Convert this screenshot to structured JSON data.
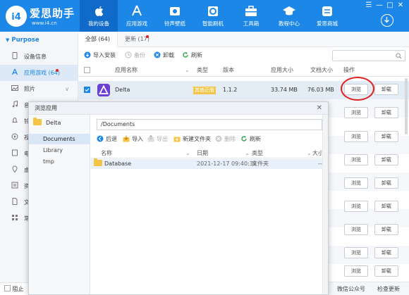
{
  "app": {
    "logo_title": "爱思助手",
    "logo_url": "www.i4.cn",
    "nav": [
      {
        "label": "我的设备",
        "icon": "apple-icon",
        "active": true
      },
      {
        "label": "应用游戏",
        "icon": "app-store-icon"
      },
      {
        "label": "铃声壁纸",
        "icon": "ringtone-icon"
      },
      {
        "label": "智能刷机",
        "icon": "flash-icon"
      },
      {
        "label": "工具箱",
        "icon": "toolbox-icon"
      },
      {
        "label": "教程中心",
        "icon": "graduation-cap-icon"
      },
      {
        "label": "爱思商城",
        "icon": "store-icon"
      }
    ],
    "window_controls": [
      "☰",
      "—",
      "□",
      "✕"
    ]
  },
  "sidebar": {
    "header": "Purpose",
    "items": [
      {
        "label": "设备信息",
        "icon": "phone-icon"
      },
      {
        "label": "应用游戏 (64)",
        "icon": "apps-icon",
        "active": true
      },
      {
        "label": "照片",
        "icon": "photo-icon"
      },
      {
        "label": "音乐",
        "icon": "music-icon"
      },
      {
        "label": "铃声",
        "icon": "bell-icon"
      },
      {
        "label": "视频",
        "icon": "video-icon"
      },
      {
        "label": "电子书",
        "icon": "book-icon"
      },
      {
        "label": "虚拟定位",
        "icon": "location-icon"
      },
      {
        "label": "资料",
        "icon": "contacts-icon"
      },
      {
        "label": "文件",
        "icon": "file-icon"
      },
      {
        "label": "常用",
        "icon": "grid-icon"
      }
    ],
    "bottom_label": "阻止"
  },
  "main": {
    "tabs": [
      {
        "label": "全部 (64)",
        "active": true
      },
      {
        "label": "更新 (17)"
      }
    ],
    "toolbar": {
      "install": "导入安装",
      "backup": "备份",
      "uninstall": "卸载",
      "refresh": "刷新"
    },
    "columns": {
      "name": "应用名称",
      "type": "类型",
      "version": "版本",
      "app_size": "应用大小",
      "doc_size": "文档大小",
      "action": "操作"
    },
    "app_row": {
      "name": "Delta",
      "badge": "其他正版",
      "version": "1.1.2",
      "app_size": "33.74 MB",
      "doc_size": "76.03 MB"
    },
    "browse_label": "浏览",
    "uninstall_label": "卸载"
  },
  "status": {
    "wechat": "微信公众号",
    "update": "检查更新"
  },
  "dialog": {
    "title": "浏览应用",
    "app_name": "Delta",
    "dirs": [
      "Documents",
      "Library",
      "tmp"
    ],
    "path": "/Documents",
    "toolbar": {
      "back": "后退",
      "import": "导入",
      "export": "导出",
      "new_folder": "新建文件夹",
      "delete": "删除",
      "refresh": "刷新"
    },
    "columns": {
      "name": "名称",
      "date": "日期",
      "type": "类型",
      "size": "大小"
    },
    "files": [
      {
        "name": "Database",
        "date": "2021-12-17 09:40:38",
        "type": "文件夹",
        "size": "--"
      }
    ]
  },
  "colors": {
    "brand": "#1c87e6",
    "badge": "#f3c64a",
    "highlight_circle": "#e0231e"
  }
}
